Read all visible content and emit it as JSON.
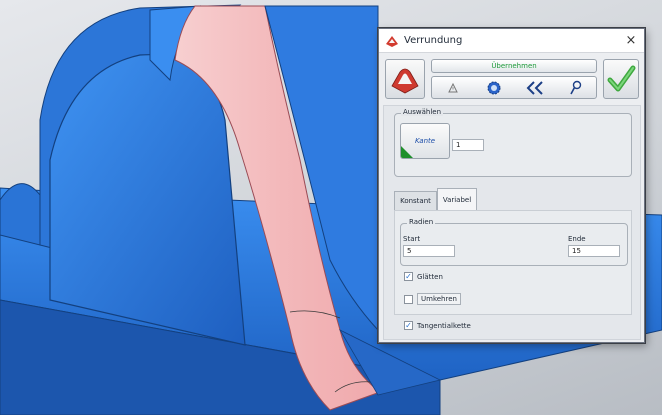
{
  "dialog": {
    "title": "Verrundung",
    "close_glyph": "×",
    "apply_label": "Übernehmen",
    "toolbar_icons": [
      "warning-icon",
      "gear-icon",
      "double-chevron-left-icon",
      "magnifier-icon"
    ],
    "ok_icon": "checkmark-icon"
  },
  "select_group": {
    "label": "Auswählen",
    "button_label": "Kante",
    "count": "1"
  },
  "tabs": {
    "konstant": "Konstant",
    "variabel": "Variabel"
  },
  "radien": {
    "label": "Radien",
    "start_label": "Start",
    "start_value": "5",
    "end_label": "Ende",
    "end_value": "15"
  },
  "options": {
    "glaetten": "Glätten",
    "glaetten_checked": true,
    "umkehren": "Umkehren",
    "umkehren_checked": false,
    "tangentialkette": "Tangentialkette",
    "tangentialkette_checked": true
  },
  "colors": {
    "part_blue": "#2f7bdc",
    "fillet_pink": "#f2b8b8",
    "ok_green": "#48b948"
  }
}
